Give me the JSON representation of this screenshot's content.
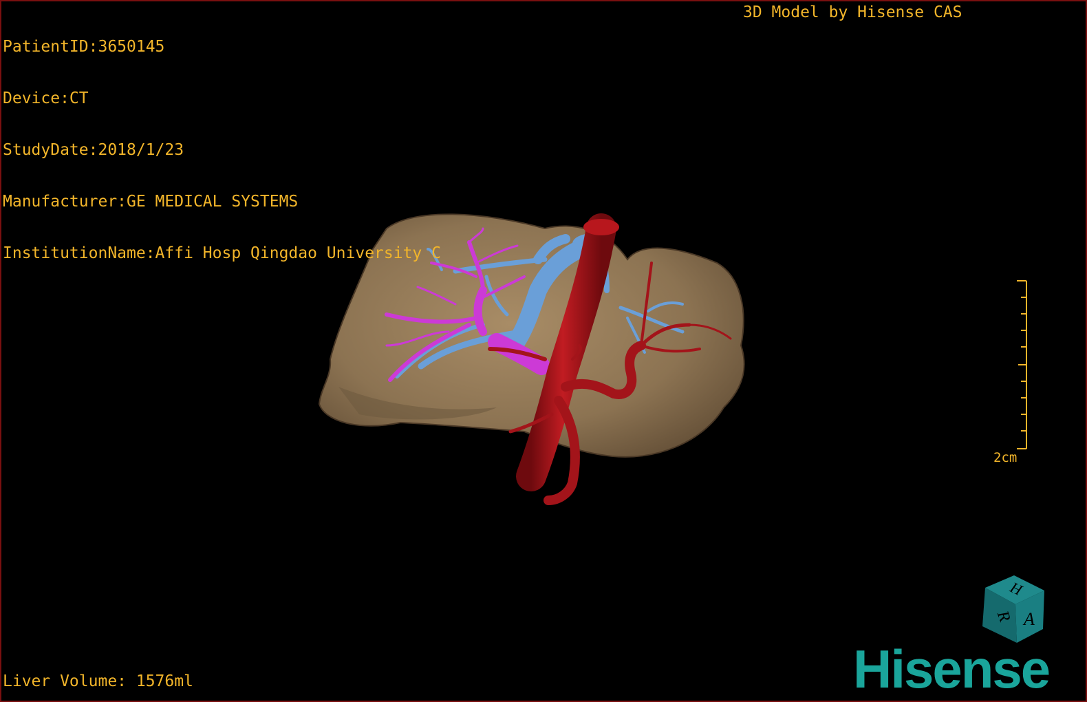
{
  "patient_info": {
    "patient_id": "PatientID:3650145",
    "device": "Device:CT",
    "study_date": "StudyDate:2018/1/23",
    "manufacturer": "Manufacturer:GE MEDICAL SYSTEMS",
    "institution": "InstitutionName:Affi Hosp Qingdao University C"
  },
  "model_label": "3D Model by Hisense CAS",
  "liver_volume": "Liver Volume: 1576ml",
  "scale_bar": {
    "label": "2cm"
  },
  "orientation_cube": {
    "letters": [
      "H",
      "R",
      "A"
    ]
  },
  "brand": "Hisense",
  "colors": {
    "text": "#f2b52a",
    "liver": "#8c7352",
    "artery": "#a3141a",
    "portal_vein": "#cc3ad6",
    "hepatic_vein": "#6a9fd8",
    "brand": "#1aa59b",
    "border": "#7a1010"
  },
  "icons": [
    "orientation-cube-icon",
    "scale-bar-icon"
  ]
}
